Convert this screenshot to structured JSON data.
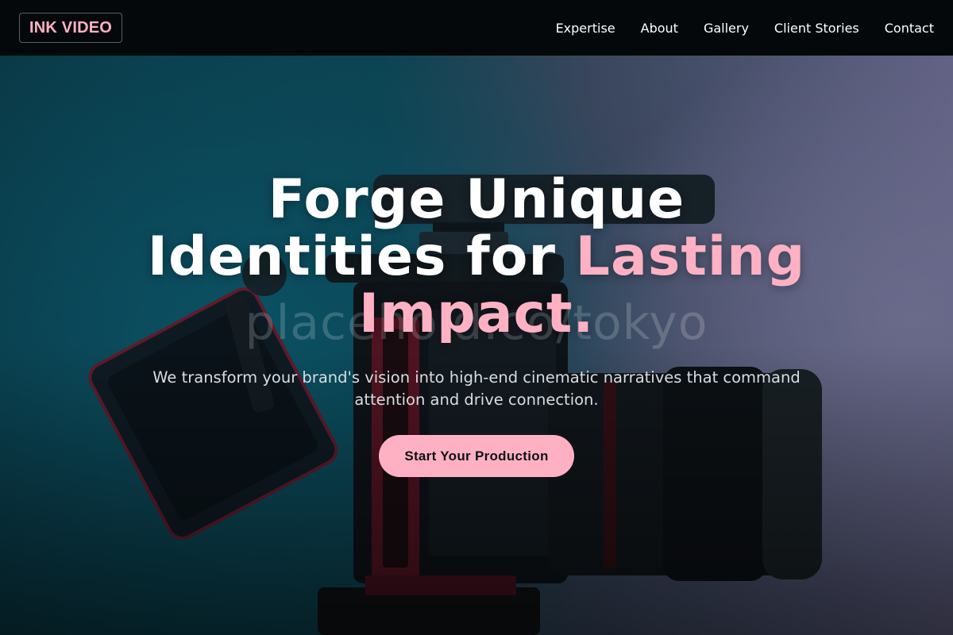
{
  "brand": {
    "name": "INK VIDEO",
    "accent_color": "#ffb1c4"
  },
  "nav": {
    "links": [
      "Expertise",
      "About",
      "Gallery",
      "Client Stories",
      "Contact"
    ]
  },
  "hero": {
    "headline": {
      "part1": "Forge Unique Identities for",
      "accent": "Lasting Impact."
    },
    "subtitle": "We transform your brand's vision into high-end cinematic narratives that command attention and drive connection.",
    "cta_label": "Start Your Production",
    "background_watermark": "placehold.co/tokyo",
    "background_image": "cinema-camera-icon"
  }
}
